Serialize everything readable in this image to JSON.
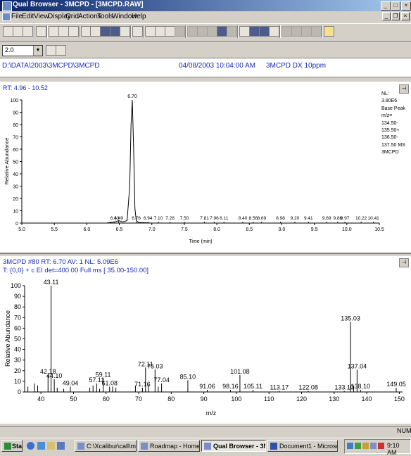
{
  "window": {
    "title": "Qual Browser - 3MCPD - [3MCPD.RAW]",
    "controls": [
      "_",
      "□",
      "×"
    ],
    "mdi_controls": [
      "_",
      "❐",
      "×"
    ]
  },
  "menu": [
    "File",
    "Edit",
    "View",
    "Display",
    "Grid",
    "Actions",
    "Tools",
    "Window",
    "Help"
  ],
  "toolbar2": {
    "zoom_value": "2.0"
  },
  "info": {
    "path": "D:\\DATA\\2003\\3MCPD\\3MCPD",
    "datetime": "04/08/2003 10:04:00 AM",
    "sample": "3MCPD DX 10ppm"
  },
  "chromatogram": {
    "rt_range": "RT: 4.96 - 10.52",
    "nl_label": "NL:",
    "nl_lines": [
      "3.80E6",
      "Base Peak",
      "m/z=",
      "134.50-",
      "135.50+",
      "136.50-",
      "137.50  MS",
      "3MCPD"
    ],
    "peak_labels": [
      {
        "t": 6.43,
        "text": "6.43",
        "h": 2
      },
      {
        "t": 6.49,
        "text": "6.49",
        "h": 3
      },
      {
        "t": 6.76,
        "text": "6.76",
        "h": 2
      },
      {
        "t": 6.94,
        "text": "6.94",
        "h": 2
      },
      {
        "t": 7.1,
        "text": "7.10",
        "h": 2
      },
      {
        "t": 7.28,
        "text": "7.28",
        "h": 2
      },
      {
        "t": 7.5,
        "text": "7.50",
        "h": 2
      },
      {
        "t": 7.81,
        "text": "7.81",
        "h": 2
      },
      {
        "t": 7.96,
        "text": "7.96",
        "h": 2
      },
      {
        "t": 8.11,
        "text": "8.11",
        "h": 2
      },
      {
        "t": 8.4,
        "text": "8.40",
        "h": 2
      },
      {
        "t": 8.56,
        "text": "8.56",
        "h": 2
      },
      {
        "t": 8.69,
        "text": "8.69",
        "h": 2
      },
      {
        "t": 8.98,
        "text": "8.98",
        "h": 2
      },
      {
        "t": 9.2,
        "text": "9.20",
        "h": 2
      },
      {
        "t": 9.41,
        "text": "9.41",
        "h": 2
      },
      {
        "t": 9.69,
        "text": "9.69",
        "h": 2
      },
      {
        "t": 9.86,
        "text": "9.86",
        "h": 2
      },
      {
        "t": 9.97,
        "text": "9.97",
        "h": 2
      },
      {
        "t": 10.22,
        "text": "10.22",
        "h": 2
      },
      {
        "t": 10.41,
        "text": "10.41",
        "h": 2
      }
    ]
  },
  "spectrum": {
    "header1": "3MCPD #80  RT: 6.70  AV: 1  NL: 5.09E6",
    "header2": "T: {0,0} + c EI det=400.00 Full ms [ 35.00-150.00]"
  },
  "chart_data": [
    {
      "type": "line",
      "title": "",
      "xlabel": "Time (min)",
      "ylabel": "Relative Abundance",
      "xlim": [
        5.0,
        10.5
      ],
      "ylim": [
        0,
        100
      ],
      "x_ticks": [
        "5.0",
        "5.5",
        "6.0",
        "6.5",
        "7.0",
        "7.5",
        "8.0",
        "8.5",
        "9.0",
        "9.5",
        "10.0",
        "10.5"
      ],
      "y_ticks": [
        "0",
        "10",
        "20",
        "30",
        "40",
        "50",
        "60",
        "70",
        "80",
        "90",
        "100"
      ],
      "series": [
        {
          "x": [
            5.0,
            6.3,
            6.43,
            6.49,
            6.55,
            6.62,
            6.66,
            6.68,
            6.7,
            6.72,
            6.74,
            6.76,
            6.8,
            7.0,
            10.5
          ],
          "y": [
            0,
            0,
            1,
            2,
            1,
            2,
            30,
            80,
            100,
            60,
            12,
            2,
            0.5,
            0,
            0
          ]
        }
      ],
      "annotations": [
        {
          "x": 6.7,
          "y": 100,
          "text": "6.70"
        }
      ]
    },
    {
      "type": "bar",
      "title": "",
      "xlabel": "m/z",
      "ylabel": "Relative Abundance",
      "xlim": [
        35,
        151
      ],
      "ylim": [
        0,
        100
      ],
      "x_ticks": [
        "40",
        "50",
        "60",
        "70",
        "80",
        "90",
        "100",
        "110",
        "120",
        "130",
        "140",
        "150"
      ],
      "y_ticks": [
        "0",
        "10",
        "20",
        "30",
        "40",
        "50",
        "60",
        "70",
        "80",
        "90",
        "100"
      ],
      "peaks": [
        {
          "x": 36.0,
          "y": 5
        },
        {
          "x": 38.0,
          "y": 8
        },
        {
          "x": 39.0,
          "y": 6
        },
        {
          "x": 42.18,
          "y": 16,
          "label": "42.18"
        },
        {
          "x": 43.11,
          "y": 100,
          "label": "43.11"
        },
        {
          "x": 44.1,
          "y": 12,
          "label": "44.10"
        },
        {
          "x": 45.0,
          "y": 4
        },
        {
          "x": 47.0,
          "y": 3
        },
        {
          "x": 49.04,
          "y": 5,
          "label": "49.04"
        },
        {
          "x": 55.0,
          "y": 4
        },
        {
          "x": 56.0,
          "y": 6
        },
        {
          "x": 57.11,
          "y": 8,
          "label": "57.11"
        },
        {
          "x": 58.0,
          "y": 3
        },
        {
          "x": 59.11,
          "y": 13,
          "label": "59.11"
        },
        {
          "x": 61.08,
          "y": 5,
          "label": "61.08"
        },
        {
          "x": 62.0,
          "y": 5
        },
        {
          "x": 63.0,
          "y": 4
        },
        {
          "x": 69.0,
          "y": 6
        },
        {
          "x": 71.16,
          "y": 4,
          "label": "71.16"
        },
        {
          "x": 72.11,
          "y": 23,
          "label": "72.11"
        },
        {
          "x": 73.0,
          "y": 7
        },
        {
          "x": 75.03,
          "y": 21,
          "label": "75.03"
        },
        {
          "x": 76.0,
          "y": 5
        },
        {
          "x": 77.04,
          "y": 8,
          "label": "77.04"
        },
        {
          "x": 85.1,
          "y": 11,
          "label": "85.10"
        },
        {
          "x": 91.06,
          "y": 2,
          "label": "91.06"
        },
        {
          "x": 98.16,
          "y": 2,
          "label": "98.16"
        },
        {
          "x": 101.08,
          "y": 16,
          "label": "101.08"
        },
        {
          "x": 105.11,
          "y": 2,
          "label": "105.11"
        },
        {
          "x": 113.17,
          "y": 1,
          "label": "113.17"
        },
        {
          "x": 122.08,
          "y": 1,
          "label": "122.08"
        },
        {
          "x": 133.1,
          "y": 1,
          "label": "133.10"
        },
        {
          "x": 135.03,
          "y": 66,
          "label": "135.03"
        },
        {
          "x": 136.0,
          "y": 6
        },
        {
          "x": 137.04,
          "y": 21,
          "label": "137.04"
        },
        {
          "x": 138.1,
          "y": 2,
          "label": "138.10"
        },
        {
          "x": 149.05,
          "y": 4,
          "label": "149.05"
        }
      ]
    }
  ],
  "taskbar": {
    "start": "Start",
    "tasks": [
      "C:\\Xcalibur\\call\\methods\\...",
      "Roadmap - Home Page",
      "Qual Browser - 3MCPD ...",
      "Document1 - Microsoft W..."
    ],
    "clock": "9:10 AM"
  },
  "status": {
    "num": "NUM"
  }
}
